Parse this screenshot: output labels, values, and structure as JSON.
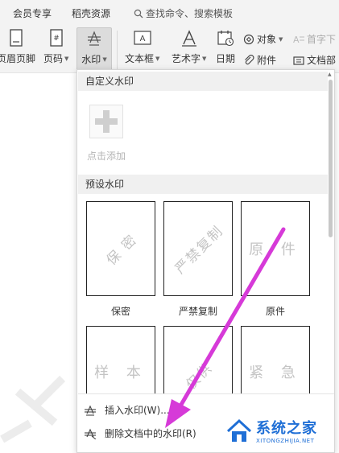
{
  "menubar": {
    "items": [
      "会员专享",
      "稻壳资源"
    ],
    "search_text": "查找命令、搜索模板"
  },
  "ribbon": {
    "header_footer": "页眉页脚",
    "page_number": "页码",
    "watermark": "水印",
    "textbox": "文本框",
    "wordart": "艺术字",
    "date": "日期",
    "object": "对象",
    "drop_cap": "首字下",
    "attachment": "附件",
    "doc_part": "文档部"
  },
  "panel": {
    "custom_header": "自定义水印",
    "add_label": "点击添加",
    "preset_header": "预设水印",
    "presets": [
      {
        "label": "保密",
        "text": "保 密"
      },
      {
        "label": "严禁复制",
        "text": "严禁复制"
      },
      {
        "label": "原件",
        "text": "原 件"
      },
      {
        "label": "",
        "text": "样 本"
      },
      {
        "label": "",
        "text": "仅供"
      },
      {
        "label": "",
        "text": "紧 急"
      }
    ],
    "insert_action": "插入水印(W)...",
    "delete_action": "删除文档中的水印(R)"
  },
  "logo": {
    "name": "系统之家",
    "sub": "XITONGZHIJIA.NET"
  },
  "colors": {
    "arrow": "#d63ad8",
    "logo": "#1f6fd6"
  }
}
